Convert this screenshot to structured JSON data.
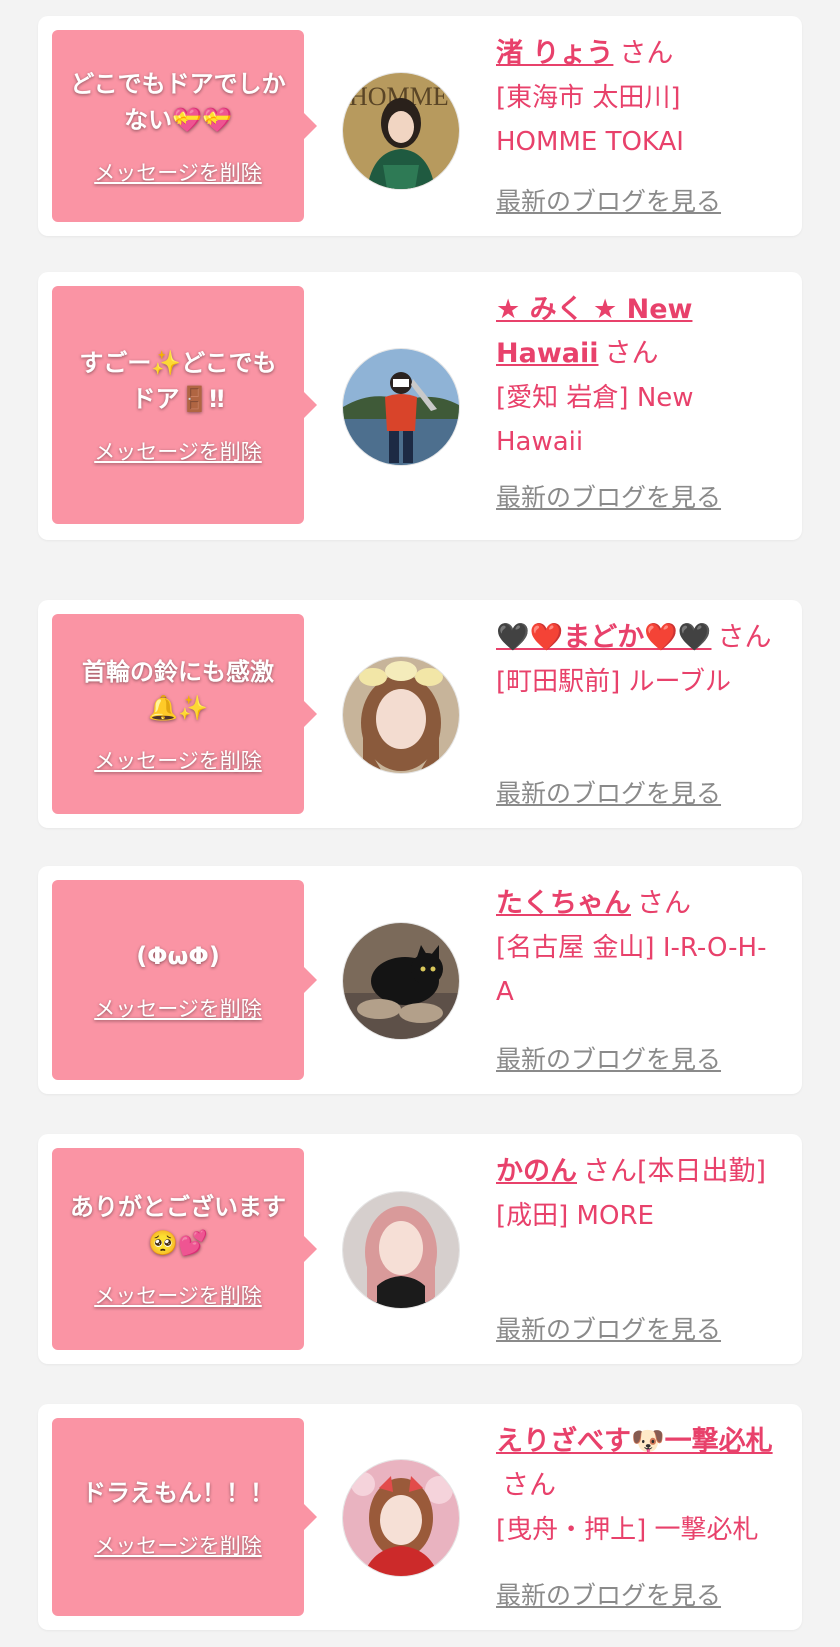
{
  "delete_label": "メッセージを削除",
  "blog_label": "最新のブログを見る",
  "cards": [
    {
      "message": "どこでもドアでしかない💝💝",
      "name": "渚 りょう",
      "honorific": "さん",
      "shop": "[東海市 太田川] HOMME TOKAI",
      "avatar": "woman-green-dress-photo"
    },
    {
      "message": "すごー✨どこでもドア🚪‼",
      "name": "★ みく ★ New Hawaii",
      "honorific": "さん",
      "shop": "[愛知 岩倉] New Hawaii",
      "avatar": "person-fishing-by-lake-photo"
    },
    {
      "message": "首輪の鈴にも感激🔔✨",
      "name": "🖤❤️まどか❤️🖤",
      "honorific": "さん",
      "shop": "[町田駅前] ルーブル",
      "avatar": "woman-with-flower-crown-photo"
    },
    {
      "message": "(ΦωΦ)",
      "name": "たくちゃん",
      "honorific": "さん",
      "shop": "[名古屋 金山] I-R-O-H-A",
      "avatar": "black-cat-photo"
    },
    {
      "message": "ありがとございます🥺💕",
      "name": "かのん",
      "honorific": "さん[本日出勤]",
      "shop": "[成田] MORE",
      "avatar": "woman-pink-hair-photo"
    },
    {
      "message": "ドラえもん！！！",
      "name": "えりざべす🐶一撃必札",
      "honorific": "さん",
      "shop": "[曳舟・押上] 一撃必札",
      "avatar": "woman-red-kimono-photo"
    }
  ]
}
